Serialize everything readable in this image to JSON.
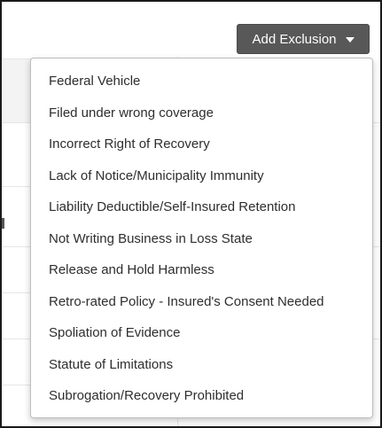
{
  "toolbar": {
    "add_exclusion_label": "Add Exclusion",
    "button_color": "#585858"
  },
  "dropdown": {
    "items": [
      {
        "label": "Federal Vehicle"
      },
      {
        "label": "Filed under wrong coverage"
      },
      {
        "label": "Incorrect Right of Recovery"
      },
      {
        "label": "Lack of Notice/Municipality Immunity"
      },
      {
        "label": "Liability Deductible/Self-Insured Retention"
      },
      {
        "label": "Not Writing Business in Loss State"
      },
      {
        "label": "Release and Hold Harmless"
      },
      {
        "label": "Retro-rated Policy - Insured's Consent Needed"
      },
      {
        "label": "Spoliation of Evidence"
      },
      {
        "label": "Statute of Limitations"
      },
      {
        "label": "Subrogation/Recovery Prohibited"
      }
    ]
  }
}
